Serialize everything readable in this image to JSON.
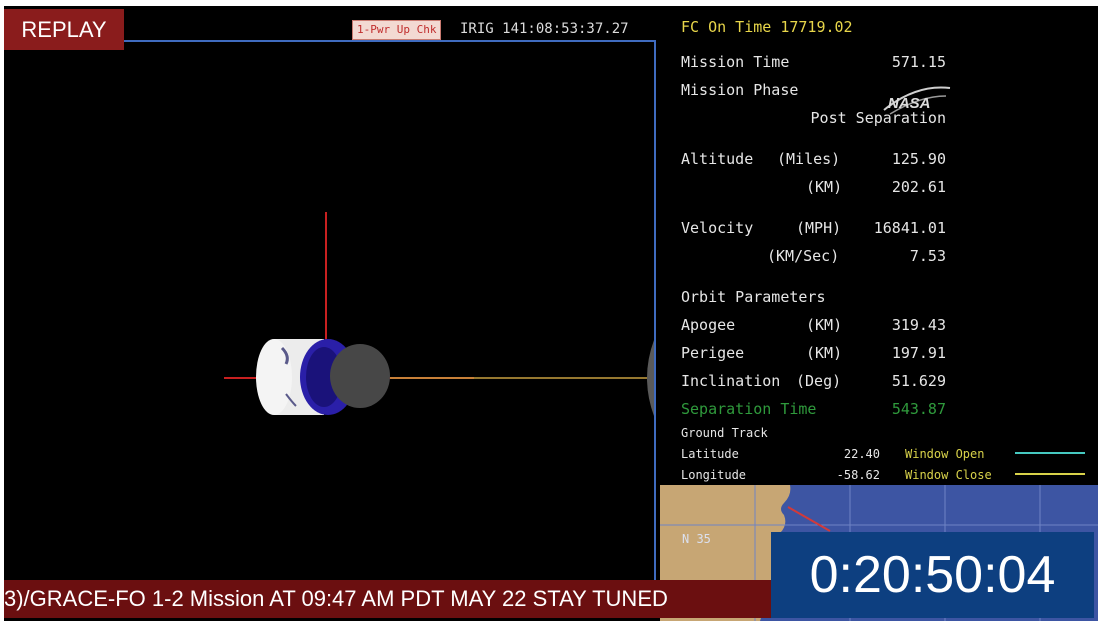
{
  "overlay": {
    "replay_label": "REPLAY",
    "ticker_text": "3)/GRACE-FO 1-2 Mission AT 09:47 AM PDT MAY 22  STAY TUNED",
    "countdown": "0:20:50:04"
  },
  "header": {
    "event_tag": "1-Pwr Up Chk",
    "irig": "IRIG 141:08:53:37.27",
    "fc_on_time": "FC On Time 17719.02"
  },
  "telemetry": {
    "mission_time_label": "Mission Time",
    "mission_time_value": "571.15",
    "mission_phase_label": "Mission Phase",
    "mission_phase_value": "Post Separation",
    "altitude_label": "Altitude",
    "altitude_miles_unit": "(Miles)",
    "altitude_miles_value": "125.90",
    "altitude_km_unit": "(KM)",
    "altitude_km_value": "202.61",
    "velocity_label": "Velocity",
    "velocity_mph_unit": "(MPH)",
    "velocity_mph_value": "16841.01",
    "velocity_kms_unit": "(KM/Sec)",
    "velocity_kms_value": "7.53",
    "orbit_params_label": "Orbit Parameters",
    "apogee_label": "Apogee",
    "apogee_unit": "(KM)",
    "apogee_value": "319.43",
    "perigee_label": "Perigee",
    "perigee_unit": "(KM)",
    "perigee_value": "197.91",
    "inclination_label": "Inclination",
    "inclination_unit": "(Deg)",
    "inclination_value": "51.629",
    "separation_label": "Separation Time",
    "separation_value": "543.87",
    "ground_track_label": "Ground Track",
    "latitude_label": "Latitude",
    "latitude_value": "22.40",
    "longitude_label": "Longitude",
    "longitude_value": "-58.62",
    "window_open_label": "Window Open",
    "window_close_label": "Window Close"
  },
  "map": {
    "lat_label": "N 35"
  },
  "logo": {
    "text": "NASA"
  },
  "colors": {
    "window_open_line": "#46c9c0",
    "window_close_line": "#d8d24a",
    "separation_text": "#2f9a3c",
    "map_background": "#3d55a3",
    "panel_border": "#3f6bbf"
  }
}
